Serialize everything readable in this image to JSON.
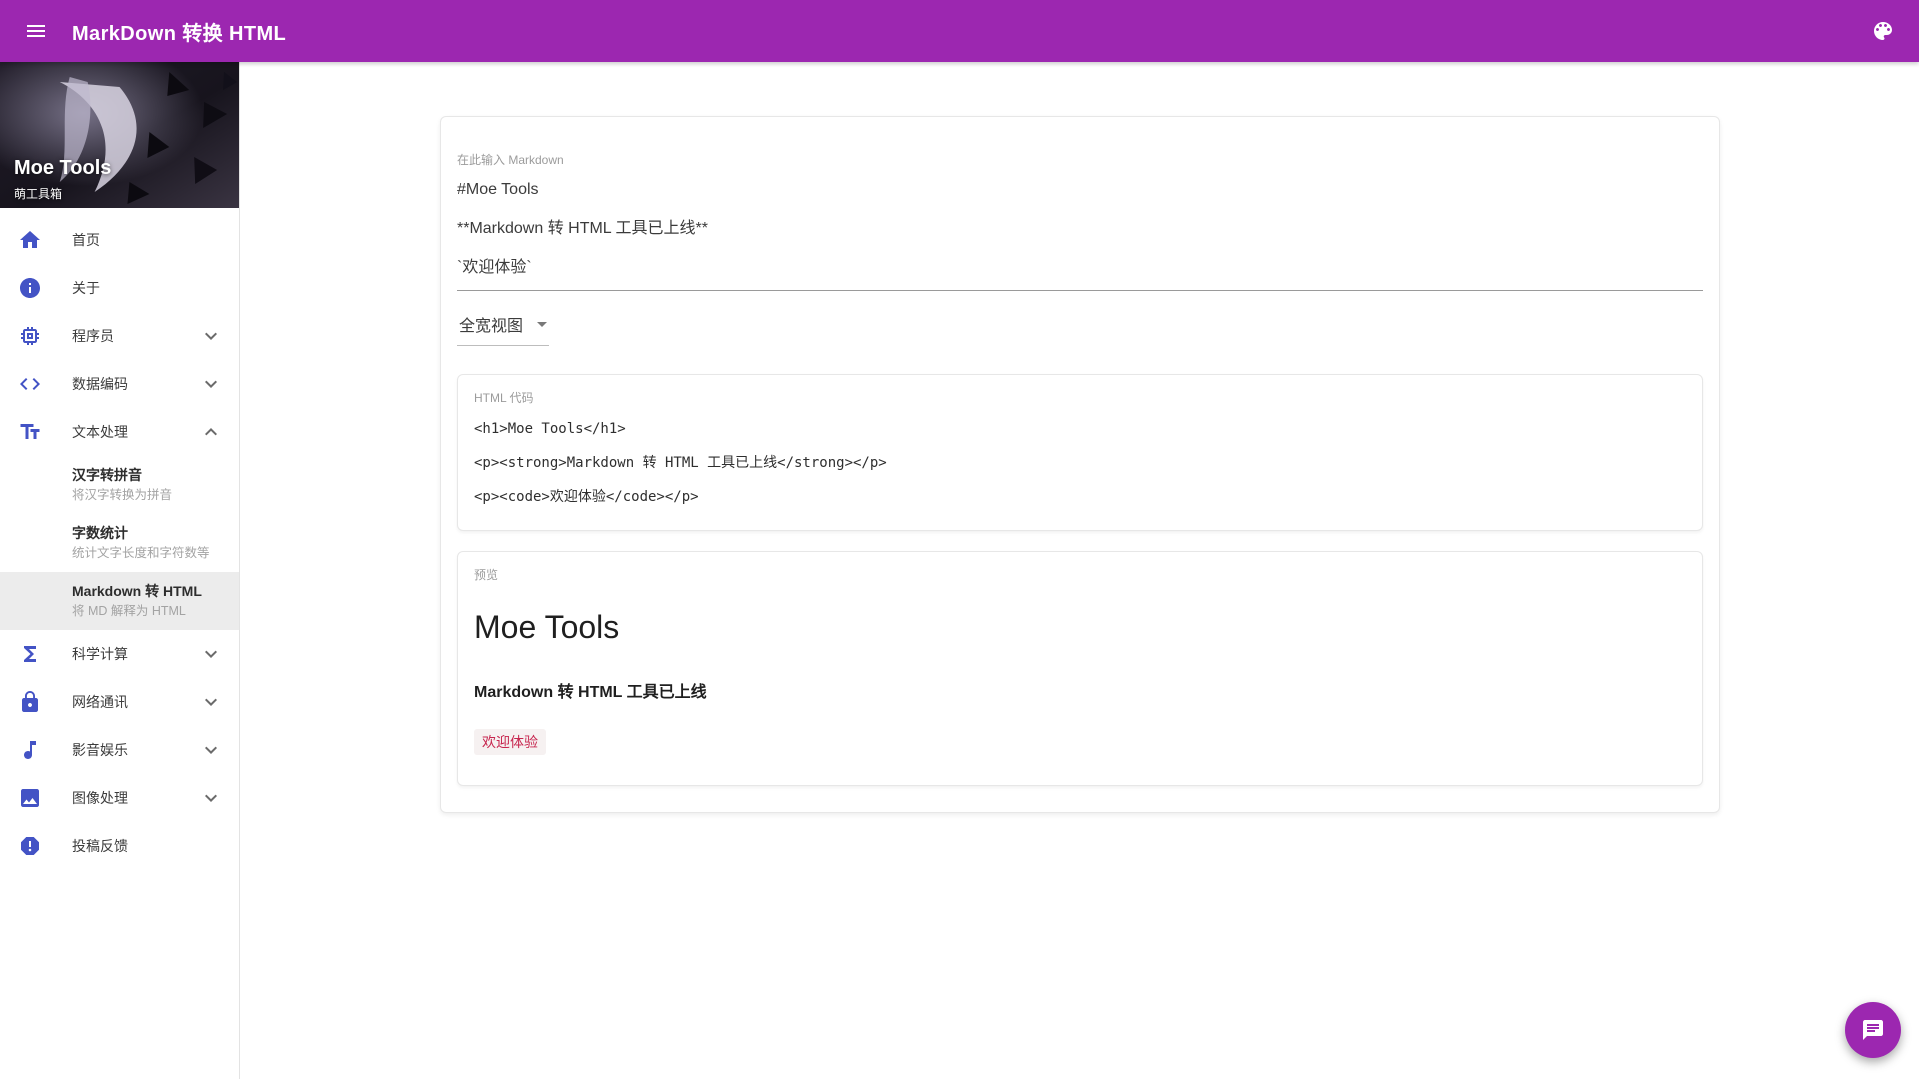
{
  "header": {
    "title": "MarkDown 转换 HTML"
  },
  "sidebar": {
    "banner": {
      "title": "Moe Tools",
      "subtitle": "萌工具箱"
    },
    "items": [
      {
        "label": "首页",
        "icon": "home-icon"
      },
      {
        "label": "关于",
        "icon": "info-icon"
      },
      {
        "label": "程序员",
        "icon": "chip-icon",
        "chevron": "down"
      },
      {
        "label": "数据编码",
        "icon": "code-icon",
        "chevron": "down"
      },
      {
        "label": "文本处理",
        "icon": "text-format-icon",
        "chevron": "up",
        "expanded": true
      },
      {
        "label": "科学计算",
        "icon": "sigma-icon",
        "chevron": "down"
      },
      {
        "label": "网络通讯",
        "icon": "lock-icon",
        "chevron": "down"
      },
      {
        "label": "影音娱乐",
        "icon": "music-note-icon",
        "chevron": "down"
      },
      {
        "label": "图像处理",
        "icon": "image-icon",
        "chevron": "down"
      },
      {
        "label": "投稿反馈",
        "icon": "report-icon"
      }
    ],
    "text_subitems": [
      {
        "title": "汉字转拼音",
        "subtitle": "将汉字转换为拼音"
      },
      {
        "title": "字数统计",
        "subtitle": "统计文字长度和字符数等"
      },
      {
        "title": "Markdown 转 HTML",
        "subtitle": "将 MD 解释为 HTML",
        "selected": true
      }
    ]
  },
  "main": {
    "markdown_input": {
      "label": "在此输入 Markdown",
      "lines": [
        "#Moe Tools",
        "**Markdown 转 HTML 工具已上线**",
        "`欢迎体验`"
      ]
    },
    "view_select": {
      "value": "全宽视图"
    },
    "html_output": {
      "label": "HTML 代码",
      "lines": [
        "<h1>Moe Tools</h1>",
        "<p><strong>Markdown 转 HTML 工具已上线</strong></p>",
        "<p><code>欢迎体验</code></p>"
      ]
    },
    "preview": {
      "label": "预览",
      "heading": "Moe Tools",
      "bold_text": "Markdown 转 HTML 工具已上线",
      "code_text": "欢迎体验"
    }
  },
  "colors": {
    "appbar_bg": "#9c27b0",
    "nav_icon_accent": "#4353c5",
    "selected_item_bg": "#ececec",
    "preview_code_color": "#c7254e",
    "fab_bg": "#9c27b0"
  }
}
